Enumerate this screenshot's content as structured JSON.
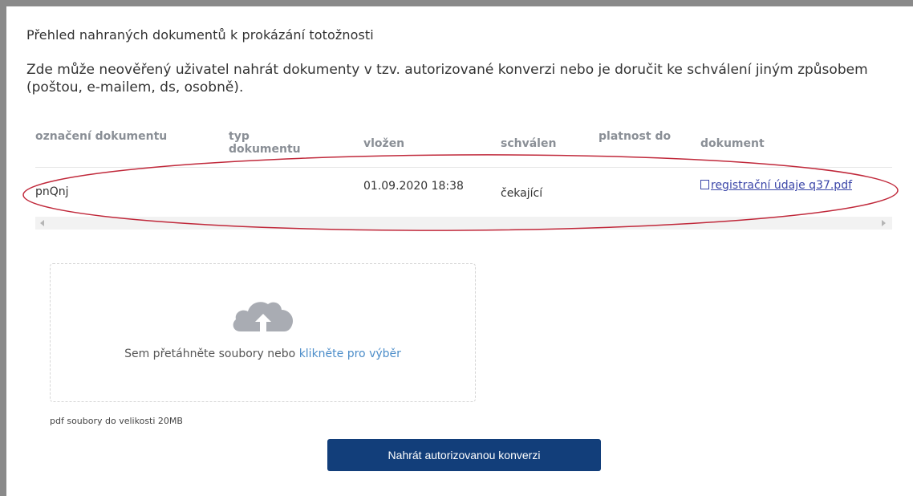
{
  "page": {
    "title": "Přehled nahraných dokumentů k prokázání totožnosti",
    "description": "Zde může neověřený uživatel nahrát dokumenty v tzv. autorizované konverzi nebo je doručit ke schválení jiným způsobem (poštou, e-mailem, ds, osobně)."
  },
  "table": {
    "headers": [
      "označení dokumentu",
      "typ dokumentu",
      "vložen",
      "schválen",
      "platnost do",
      "dokument"
    ],
    "rows": [
      {
        "designation": "pnQnj",
        "type": "",
        "inserted": "01.09.2020 18:38",
        "approved": "čekající",
        "valid_until": "",
        "document": "registrační údaje q37.pdf"
      }
    ]
  },
  "dropzone": {
    "text": "Sem přetáhněte soubory nebo",
    "link": "klikněte pro výběr",
    "icon": "cloud-upload-icon"
  },
  "note": "pdf soubory do velikosti 20MB",
  "upload_button": "Nahrát autorizovanou konverzi",
  "colors": {
    "button": "#123e7a",
    "link": "#3b46a8",
    "drop_link": "#4c8dc9",
    "annotation": "#c0283a"
  }
}
